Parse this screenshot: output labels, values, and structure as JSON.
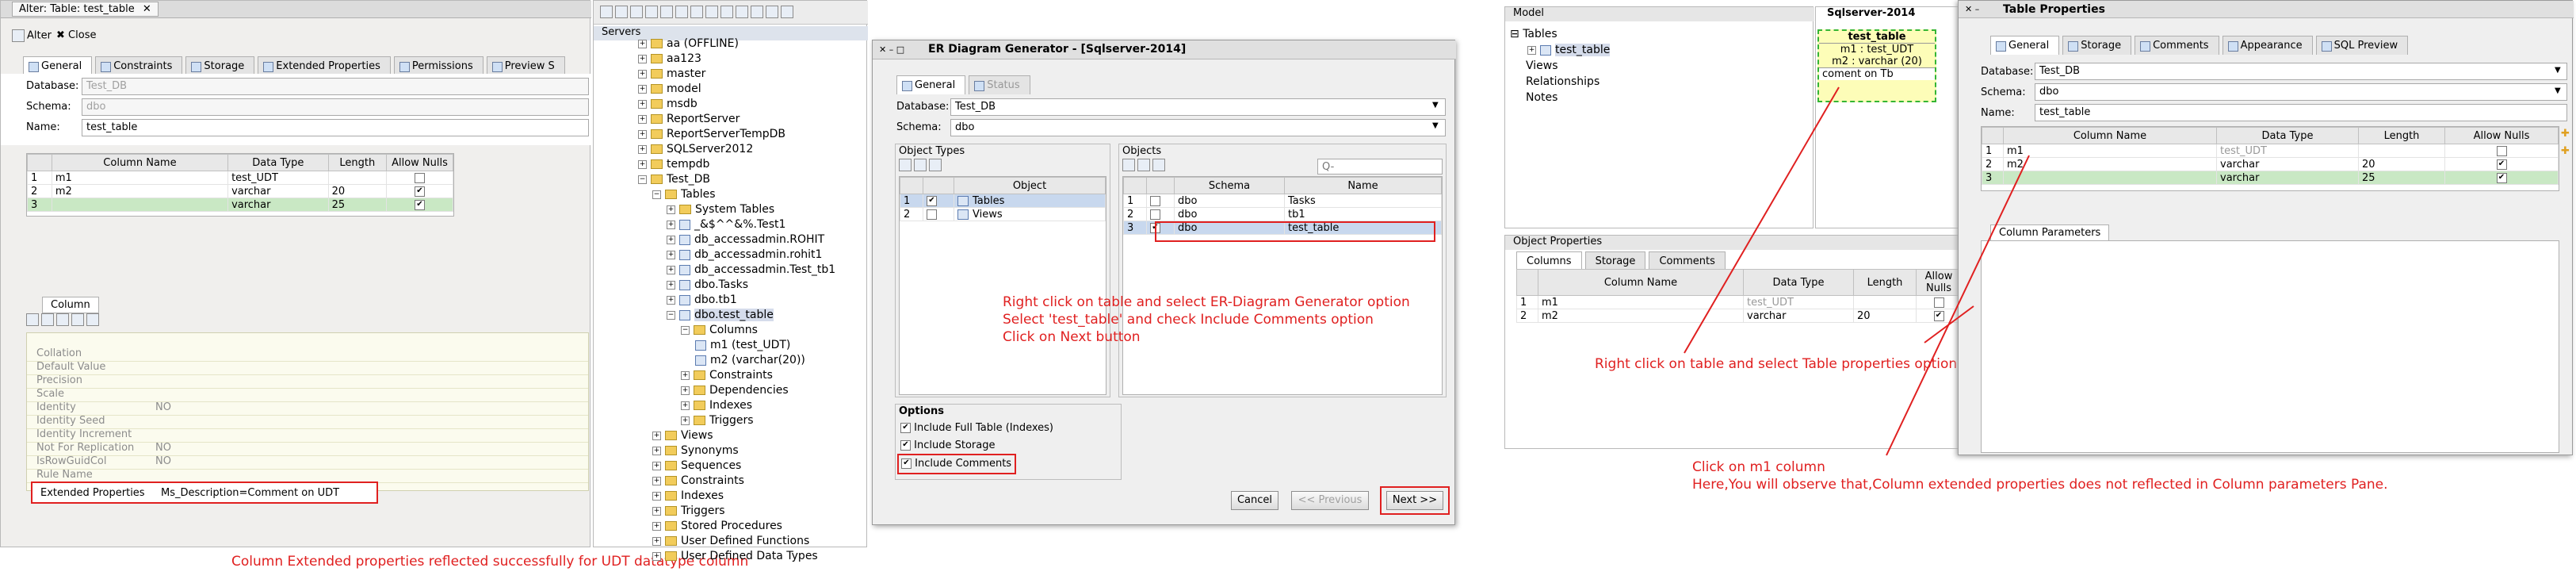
{
  "alter": {
    "title": "Alter: Table: test_table",
    "alter_label": "Alter",
    "close_label": "Close",
    "tabs": [
      "General",
      "Constraints",
      "Storage",
      "Extended Properties",
      "Permissions",
      "Preview S"
    ],
    "database_label": "Database:",
    "database_value": "Test_DB",
    "schema_label": "Schema:",
    "schema_value": "dbo",
    "name_label": "Name:",
    "name_value": "test_table",
    "columns_header": [
      "",
      "Column Name",
      "Data Type",
      "Length",
      "Allow Nulls"
    ],
    "rows": [
      {
        "num": "1",
        "name": "m1",
        "type": "test_UDT",
        "length": "",
        "nulls": false
      },
      {
        "num": "2",
        "name": "m2",
        "type": "varchar",
        "length": "20",
        "nulls": true
      },
      {
        "num": "3",
        "name": "",
        "type": "varchar",
        "length": "25",
        "nulls": true
      }
    ],
    "column_tab": "Column",
    "props": [
      {
        "k": "Collation",
        "v": ""
      },
      {
        "k": "Default Value",
        "v": ""
      },
      {
        "k": "Precision",
        "v": ""
      },
      {
        "k": "Scale",
        "v": ""
      },
      {
        "k": "Identity",
        "v": "NO"
      },
      {
        "k": "Identity Seed",
        "v": ""
      },
      {
        "k": "Identity Increment",
        "v": ""
      },
      {
        "k": "Not For Replication",
        "v": "NO"
      },
      {
        "k": "IsRowGuidCol",
        "v": "NO"
      },
      {
        "k": "Rule Name",
        "v": ""
      }
    ],
    "ext_key": "Extended Properties",
    "ext_value": "Ms_Description=Comment on UDT"
  },
  "annotations": {
    "udt": "Column Extended properties reflected successfully for UDT datatype column",
    "er_1": "Right click on table and select ER-Diagram Generator option",
    "er_2": "Select 'test_table' and check Include Comments option",
    "er_3": "Click on Next button",
    "props": "Right click on table and select Table properties option",
    "m1_1": "Click on m1 column",
    "m1_2": "Here,You will observe that,Column extended properties does not reflected in Column parameters Pane."
  },
  "servers": {
    "title": "Servers",
    "items": [
      {
        "label": "aa (OFFLINE)",
        "d": 0,
        "k": "db"
      },
      {
        "label": "aa123",
        "d": 0,
        "k": "db"
      },
      {
        "label": "master",
        "d": 0,
        "k": "db"
      },
      {
        "label": "model",
        "d": 0,
        "k": "db"
      },
      {
        "label": "msdb",
        "d": 0,
        "k": "db"
      },
      {
        "label": "ReportServer",
        "d": 0,
        "k": "db"
      },
      {
        "label": "ReportServerTempDB",
        "d": 0,
        "k": "db"
      },
      {
        "label": "SQLServer2012",
        "d": 0,
        "k": "db"
      },
      {
        "label": "tempdb",
        "d": 0,
        "k": "db"
      },
      {
        "label": "Test_DB",
        "d": 0,
        "k": "db"
      },
      {
        "label": "Tables",
        "d": 1,
        "k": "folder"
      },
      {
        "label": "System Tables",
        "d": 2,
        "k": "folder"
      },
      {
        "label": "_&$^^&%.Test1",
        "d": 2,
        "k": "table"
      },
      {
        "label": "db_accessadmin.ROHIT",
        "d": 2,
        "k": "table"
      },
      {
        "label": "db_accessadmin.rohit1",
        "d": 2,
        "k": "table"
      },
      {
        "label": "db_accessadmin.Test_tb1",
        "d": 2,
        "k": "table"
      },
      {
        "label": "dbo.Tasks",
        "d": 2,
        "k": "table"
      },
      {
        "label": "dbo.tb1",
        "d": 2,
        "k": "table"
      },
      {
        "label": "dbo.test_table",
        "d": 2,
        "k": "table",
        "sel": true
      },
      {
        "label": "Columns",
        "d": 3,
        "k": "folder"
      },
      {
        "label": "m1 (test_UDT)",
        "d": 4,
        "k": "col"
      },
      {
        "label": "m2 (varchar(20))",
        "d": 4,
        "k": "col"
      },
      {
        "label": "Constraints",
        "d": 3,
        "k": "folder"
      },
      {
        "label": "Dependencies",
        "d": 3,
        "k": "folder"
      },
      {
        "label": "Indexes",
        "d": 3,
        "k": "folder"
      },
      {
        "label": "Triggers",
        "d": 3,
        "k": "folder"
      },
      {
        "label": "Views",
        "d": 1,
        "k": "folder"
      },
      {
        "label": "Synonyms",
        "d": 1,
        "k": "folder"
      },
      {
        "label": "Sequences",
        "d": 1,
        "k": "folder"
      },
      {
        "label": "Constraints",
        "d": 1,
        "k": "folder"
      },
      {
        "label": "Indexes",
        "d": 1,
        "k": "folder"
      },
      {
        "label": "Triggers",
        "d": 1,
        "k": "folder"
      },
      {
        "label": "Stored Procedures",
        "d": 1,
        "k": "folder"
      },
      {
        "label": "User Defined Functions",
        "d": 1,
        "k": "folder"
      },
      {
        "label": "User Defined Data Types",
        "d": 1,
        "k": "folder"
      }
    ]
  },
  "er": {
    "title": "ER Diagram Generator - [Sqlserver-2014]",
    "tab_general": "General",
    "tab_status": "Status",
    "database_label": "Database:",
    "database_value": "Test_DB",
    "schema_label": "Schema:",
    "schema_value": "dbo",
    "object_types_label": "Object Types",
    "object_types_header": [
      "",
      "",
      "Object"
    ],
    "object_types": [
      {
        "num": "1",
        "label": "Tables",
        "checked": true,
        "sel": true
      },
      {
        "num": "2",
        "label": "Views",
        "checked": false,
        "sel": false
      }
    ],
    "objects_label": "Objects",
    "search_placeholder": "Q-",
    "objects_header": [
      "",
      "",
      "Schema",
      "Name"
    ],
    "objects": [
      {
        "num": "1",
        "schema": "dbo",
        "name": "Tasks",
        "checked": false,
        "sel": false
      },
      {
        "num": "2",
        "schema": "dbo",
        "name": "tb1",
        "checked": false,
        "sel": false
      },
      {
        "num": "3",
        "schema": "dbo",
        "name": "test_table",
        "checked": true,
        "sel": true
      }
    ],
    "options_label": "Options",
    "options": [
      "Include Full Table (Indexes)",
      "Include Storage",
      "Include Comments"
    ],
    "cancel": "Cancel",
    "previous": "<< Previous",
    "next": "Next >>"
  },
  "model": {
    "title": "Model",
    "items": [
      "Tables",
      "test_table",
      "Views",
      "Relationships",
      "Notes"
    ],
    "canvas_tab": "Sqlserver-2014",
    "entity_title": "test_table",
    "entity_cols": [
      "m1 : test_UDT",
      "m2 : varchar (20)"
    ],
    "entity_comment": "coment on Tb"
  },
  "objprops": {
    "title": "Object Properties",
    "tabs": [
      "Columns",
      "Storage",
      "Comments"
    ],
    "header": [
      "",
      "Column Name",
      "Data Type",
      "Length",
      "Allow Nulls"
    ],
    "rows": [
      {
        "num": "1",
        "name": "m1",
        "type": "test_UDT",
        "length": "",
        "nulls": false
      },
      {
        "num": "2",
        "name": "m2",
        "type": "varchar",
        "length": "20",
        "nulls": true
      }
    ]
  },
  "tableprops": {
    "title": "Table Properties",
    "tabs": [
      "General",
      "Storage",
      "Comments",
      "Appearance",
      "SQL Preview"
    ],
    "database_label": "Database:",
    "database_value": "Test_DB",
    "schema_label": "Schema:",
    "schema_value": "dbo",
    "name_label": "Name:",
    "name_value": "test_table",
    "header": [
      "",
      "Column Name",
      "Data Type",
      "Length",
      "Allow Nulls"
    ],
    "rows": [
      {
        "num": "1",
        "name": "m1",
        "type": "test_UDT",
        "length": "",
        "nulls": false
      },
      {
        "num": "2",
        "name": "m2",
        "type": "varchar",
        "length": "20",
        "nulls": true
      },
      {
        "num": "3",
        "name": "",
        "type": "varchar",
        "length": "25",
        "nulls": true
      }
    ],
    "params_tab": "Column Parameters"
  },
  "colors": {
    "annotation": "#e02020",
    "selected_row": "#c9e8c4",
    "entity_bg": "#fdfdb8"
  }
}
